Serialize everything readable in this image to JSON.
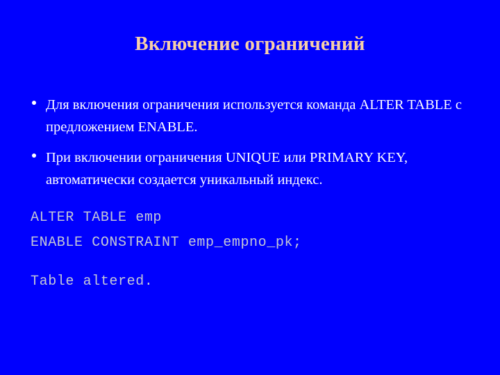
{
  "slide": {
    "background_color": "#0000FE",
    "title": "Включение ограничений",
    "title_color": "#F7CFA9"
  },
  "bullets": {
    "marker": "bullet-dot",
    "text_color": "#FFFFFF",
    "items": [
      {
        "text": "Для включения ограничения используется команда ALTER TABLE с предложением ENABLE."
      },
      {
        "text": "При включении ограничения UNIQUE или PRIMARY KEY, автоматически создается уникальный индекс."
      }
    ]
  },
  "code_block": {
    "text_color": "#C3C7D6",
    "lines": [
      {
        "text": "ALTER TABLE emp",
        "blank": false
      },
      {
        "text": "ENABLE CONSTRAINT emp_empno_pk;",
        "blank": false
      },
      {
        "text": " ",
        "blank": true
      },
      {
        "text": "Table altered.",
        "blank": false
      }
    ]
  }
}
